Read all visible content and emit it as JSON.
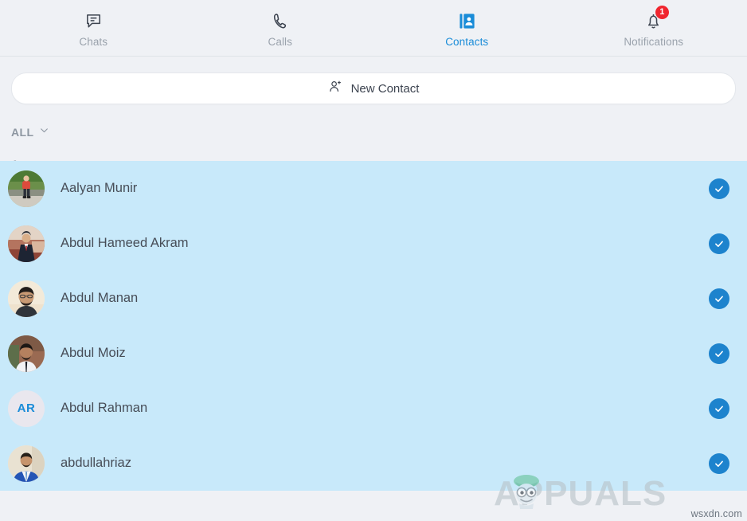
{
  "nav": {
    "tabs": [
      {
        "label": "Chats",
        "icon": "chat-bubble-icon",
        "active": false,
        "badge": null
      },
      {
        "label": "Calls",
        "icon": "phone-icon",
        "active": false,
        "badge": null
      },
      {
        "label": "Contacts",
        "icon": "contact-card-icon",
        "active": true,
        "badge": null
      },
      {
        "label": "Notifications",
        "icon": "bell-icon",
        "active": false,
        "badge": "1"
      }
    ],
    "active_color": "#1a8cd8",
    "inactive_color": "#9aa2ac",
    "badge_color": "#f0262f"
  },
  "toolbar": {
    "new_contact_label": "New Contact",
    "new_contact_icon": "person-plus-icon"
  },
  "filter": {
    "label": "ALL",
    "icon": "chevron-down-icon"
  },
  "list": {
    "section_letter": "A",
    "selected_row_color": "#c8e9fa",
    "check_color": "#1d83cd",
    "contacts": [
      {
        "name": "Aalyan Munir",
        "avatar_type": "photo",
        "avatar_style": "outdoor-red-shirt",
        "initials": "",
        "selected": true
      },
      {
        "name": "Abdul Hameed Akram",
        "avatar_type": "photo",
        "avatar_style": "dark-suit-red-room",
        "initials": "",
        "selected": true
      },
      {
        "name": "Abdul Manan",
        "avatar_type": "photo",
        "avatar_style": "bearded-cream",
        "initials": "",
        "selected": true
      },
      {
        "name": "Abdul Moiz",
        "avatar_type": "photo",
        "avatar_style": "white-shirt-brick",
        "initials": "",
        "selected": true
      },
      {
        "name": "Abdul Rahman",
        "avatar_type": "initials",
        "avatar_style": "",
        "initials": "AR",
        "selected": true
      },
      {
        "name": "abdullahriaz",
        "avatar_type": "photo",
        "avatar_style": "blue-suit",
        "initials": "",
        "selected": true
      }
    ]
  },
  "watermark": {
    "brand": "APPUALS",
    "site": "wsxdn.com"
  }
}
